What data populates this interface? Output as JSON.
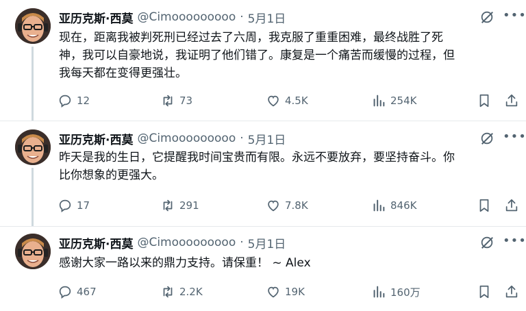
{
  "tweets": [
    {
      "author": "亚历克斯·西莫",
      "handle": "@Cimooooooooo",
      "separator": "·",
      "date": "5月1日",
      "lines": [
        "现在，距离我被判死刑已经过去了六周，我克服了重重困难，最终战胜了死",
        "神，我可以自豪地说，我证明了他们错了。康复是一个痛苦而缓慢的过程，但",
        "我每天都在变得更强壮。"
      ],
      "replies": "12",
      "retweets": "73",
      "likes": "4.5K",
      "views": "254K"
    },
    {
      "author": "亚历克斯·西莫",
      "handle": "@Cimooooooooo",
      "separator": "·",
      "date": "5月1日",
      "lines": [
        "昨天是我的生日，它提醒我时间宝贵而有限。永远不要放弃，要坚持奋斗。你",
        "比你想象的更强大。"
      ],
      "replies": "17",
      "retweets": "291",
      "likes": "7.8K",
      "views": "846K"
    },
    {
      "author": "亚历克斯·西莫",
      "handle": "@Cimooooooooo",
      "separator": "·",
      "date": "5月1日",
      "lines": [
        "感谢大家一路以来的鼎力支持。请保重！ ~ Alex"
      ],
      "replies": "467",
      "retweets": "2.2K",
      "likes": "19K",
      "views": "160万"
    }
  ],
  "icons": {
    "reply": "reply-icon",
    "retweet": "retweet-icon",
    "like": "heart-icon",
    "views": "views-icon",
    "bookmark": "bookmark-icon",
    "share": "share-icon",
    "grok": "grok-icon",
    "more": "more-icon"
  },
  "colors": {
    "text": "#0f1419",
    "muted": "#536471",
    "thread_line": "#cfd9de",
    "divider": "#e6e9ec"
  }
}
